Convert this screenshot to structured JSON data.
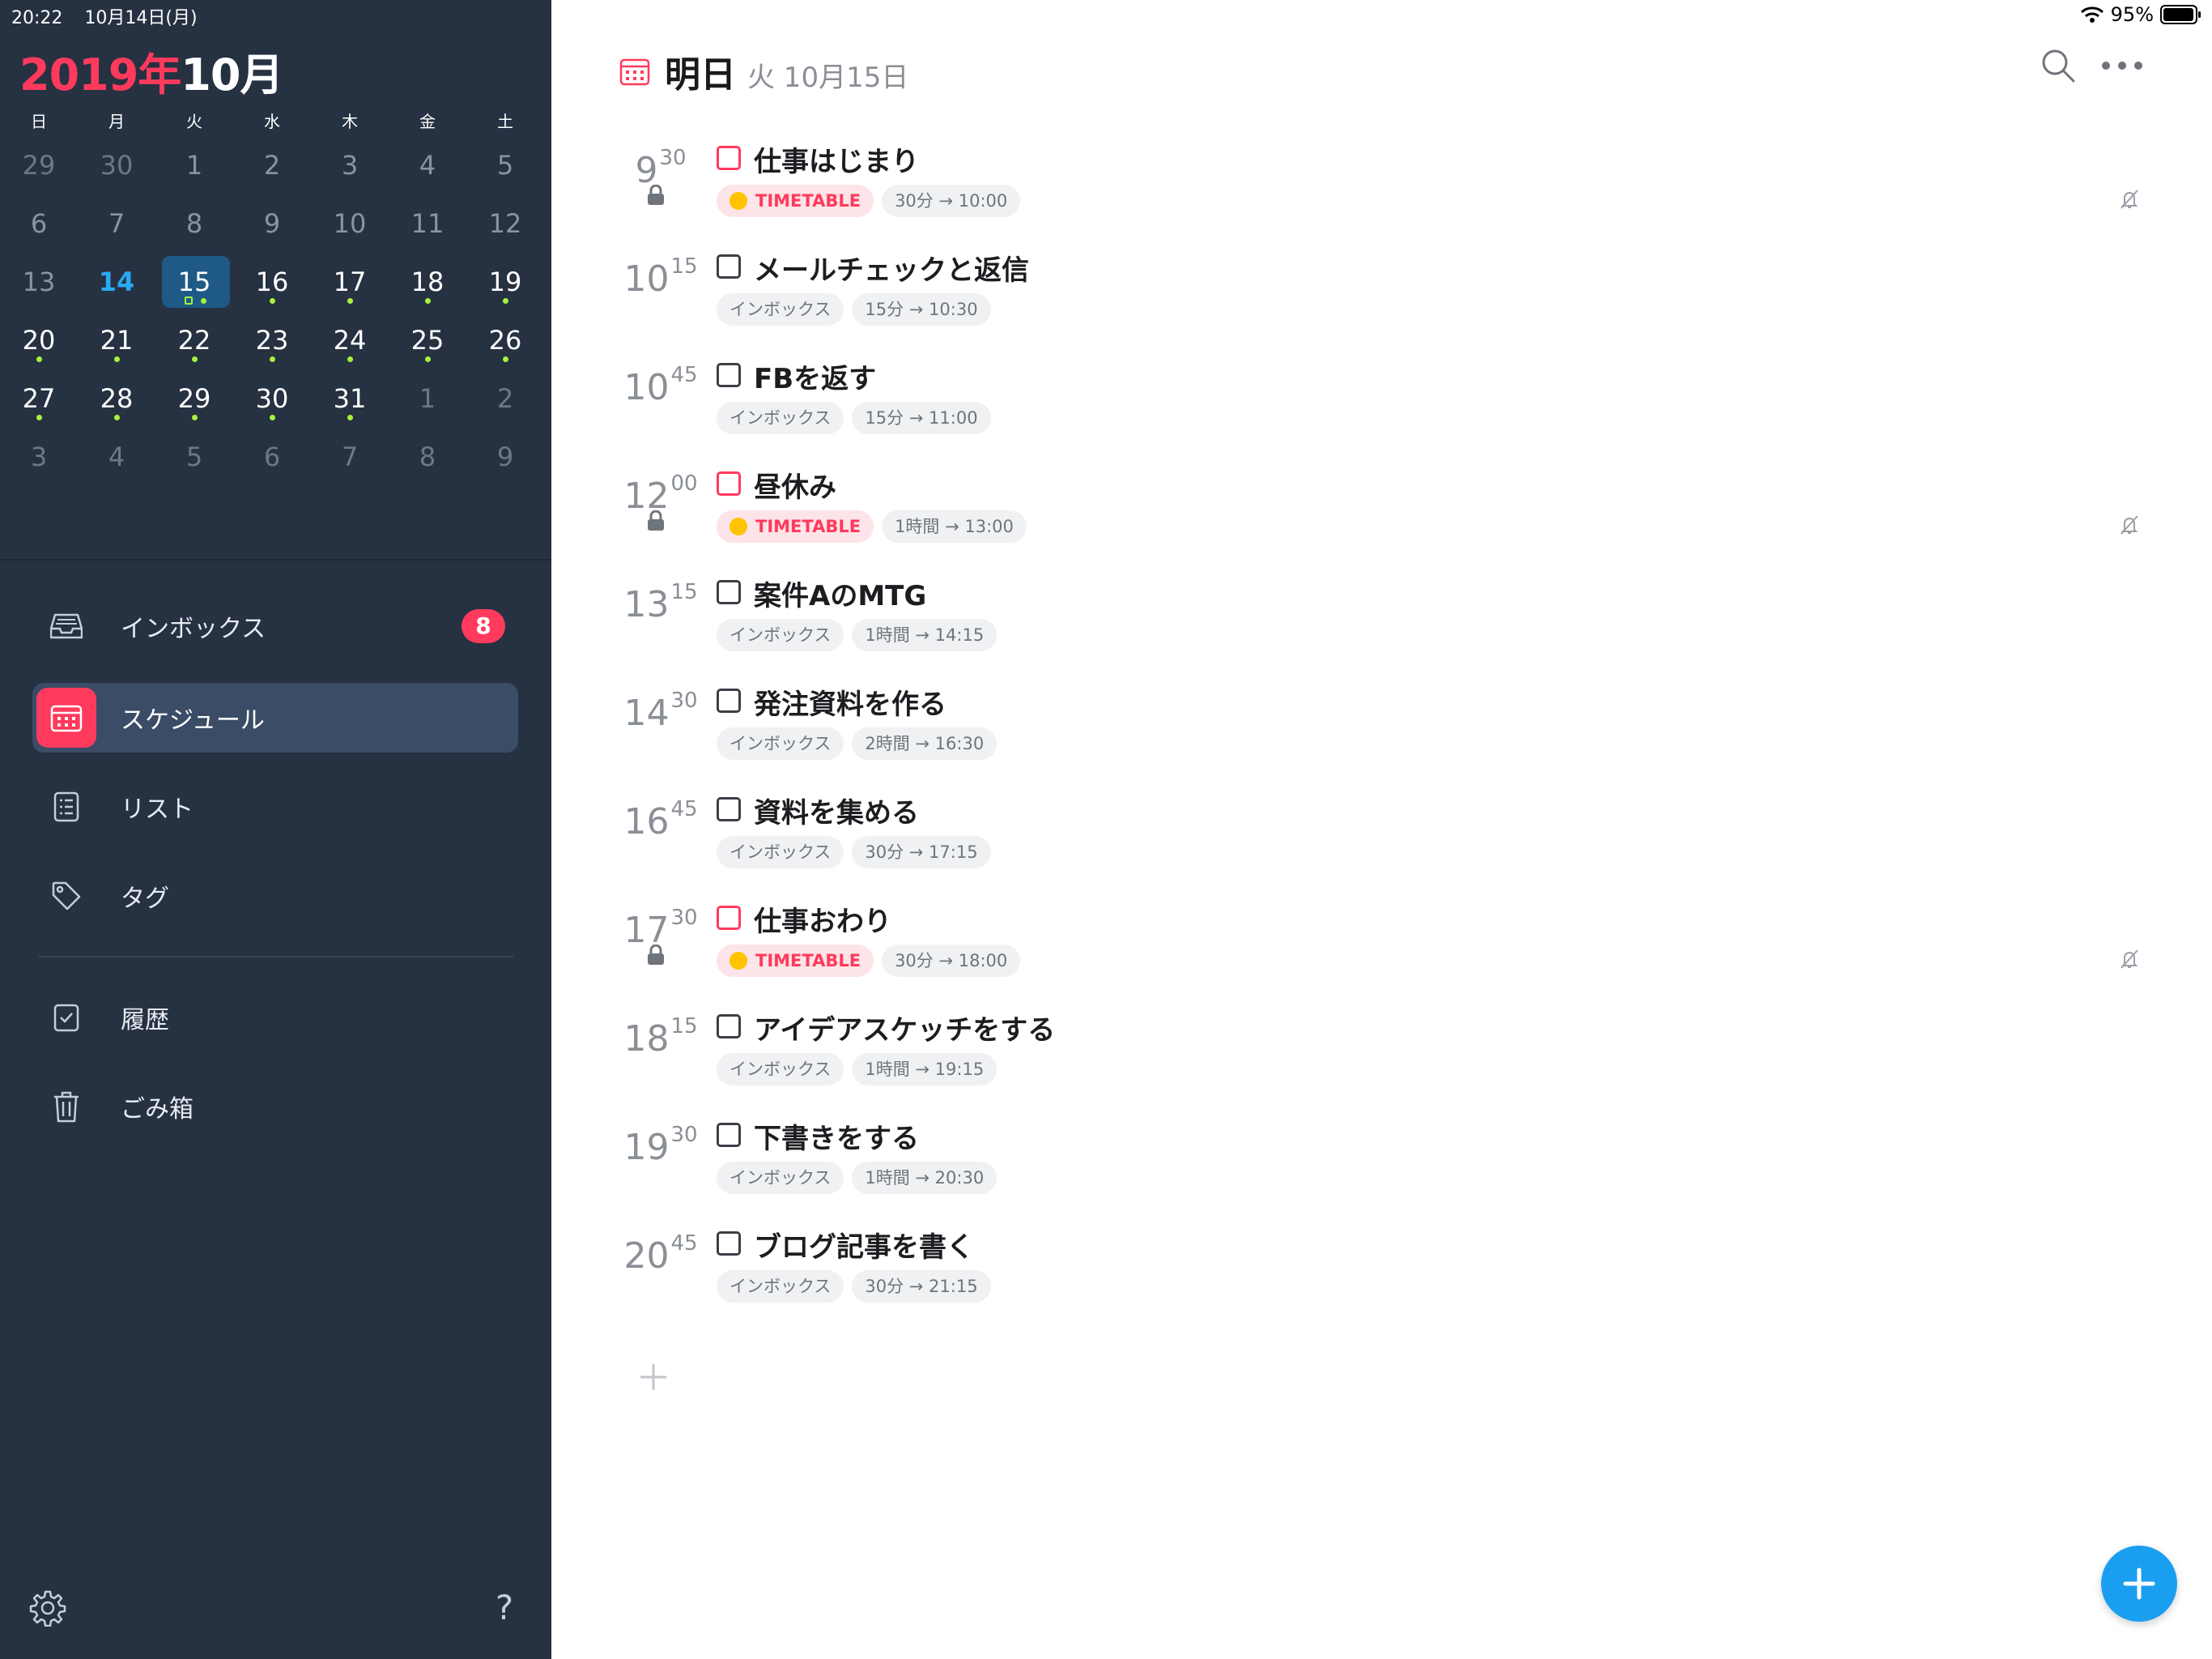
{
  "status_bar": {
    "time": "20:22",
    "date": "10月14日(月)",
    "battery": "95%"
  },
  "calendar": {
    "year_label": "2019年",
    "month_label": "10月",
    "weekdays": [
      "日",
      "月",
      "火",
      "水",
      "木",
      "金",
      "土"
    ],
    "weeks": [
      [
        "29",
        "30",
        "1",
        "2",
        "3",
        "4",
        "5"
      ],
      [
        "6",
        "7",
        "8",
        "9",
        "10",
        "11",
        "12"
      ],
      [
        "13",
        "14",
        "15",
        "16",
        "17",
        "18",
        "19"
      ],
      [
        "20",
        "21",
        "22",
        "23",
        "24",
        "25",
        "26"
      ],
      [
        "27",
        "28",
        "29",
        "30",
        "31",
        "1",
        "2"
      ],
      [
        "3",
        "4",
        "5",
        "6",
        "7",
        "8",
        "9"
      ]
    ],
    "today": "14",
    "selected": "15",
    "accent_color": "#ff3a5c",
    "today_color": "#2aa8f2",
    "dot_color": "#a6f23d"
  },
  "nav": {
    "inbox": {
      "label": "インボックス",
      "badge": "8",
      "icon": "inbox-tray-icon"
    },
    "schedule": {
      "label": "スケジュール",
      "icon": "calendar-icon"
    },
    "list": {
      "label": "リスト",
      "icon": "list-icon"
    },
    "tags": {
      "label": "タグ",
      "icon": "tag-icon"
    },
    "history": {
      "label": "履歴",
      "icon": "checked-square-icon"
    },
    "trash": {
      "label": "ごみ箱",
      "icon": "trash-icon"
    }
  },
  "footer": {
    "help": "?"
  },
  "header": {
    "title": "明日",
    "subtitle": "火 10月15日"
  },
  "tasks": [
    {
      "hour": "9",
      "min": "30",
      "title": "仕事はじまり",
      "tag": "TIMETABLE",
      "duration": "30分 → 10:00",
      "locked": true,
      "timetable": true
    },
    {
      "hour": "10",
      "min": "15",
      "title": "メールチェックと返信",
      "tag": "インボックス",
      "duration": "15分 → 10:30",
      "locked": false,
      "timetable": false
    },
    {
      "hour": "10",
      "min": "45",
      "title": "FBを返す",
      "tag": "インボックス",
      "duration": "15分 → 11:00",
      "locked": false,
      "timetable": false
    },
    {
      "hour": "12",
      "min": "00",
      "title": "昼休み",
      "tag": "TIMETABLE",
      "duration": "1時間 → 13:00",
      "locked": true,
      "timetable": true
    },
    {
      "hour": "13",
      "min": "15",
      "title": "案件AのMTG",
      "tag": "インボックス",
      "duration": "1時間 → 14:15",
      "locked": false,
      "timetable": false
    },
    {
      "hour": "14",
      "min": "30",
      "title": "発注資料を作る",
      "tag": "インボックス",
      "duration": "2時間 → 16:30",
      "locked": false,
      "timetable": false
    },
    {
      "hour": "16",
      "min": "45",
      "title": "資料を集める",
      "tag": "インボックス",
      "duration": "30分 → 17:15",
      "locked": false,
      "timetable": false
    },
    {
      "hour": "17",
      "min": "30",
      "title": "仕事おわり",
      "tag": "TIMETABLE",
      "duration": "30分 → 18:00",
      "locked": true,
      "timetable": true
    },
    {
      "hour": "18",
      "min": "15",
      "title": "アイデアスケッチをする",
      "tag": "インボックス",
      "duration": "1時間 → 19:15",
      "locked": false,
      "timetable": false
    },
    {
      "hour": "19",
      "min": "30",
      "title": "下書きをする",
      "tag": "インボックス",
      "duration": "1時間 → 20:30",
      "locked": false,
      "timetable": false
    },
    {
      "hour": "20",
      "min": "45",
      "title": "ブログ記事を書く",
      "tag": "インボックス",
      "duration": "30分 → 21:15",
      "locked": false,
      "timetable": false
    }
  ]
}
